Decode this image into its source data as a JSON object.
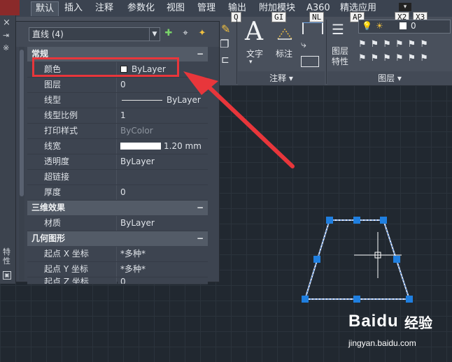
{
  "tabs": [
    "默认",
    "插入",
    "注释",
    "参数化",
    "视图",
    "管理",
    "输出",
    "附加模块",
    "A360",
    "精选应用"
  ],
  "keytips": [
    "O",
    "GI",
    "NL",
    "AP",
    "X2",
    "X3"
  ],
  "ribbon": {
    "text_label": "文字",
    "dim_label": "标注",
    "layer_props_label": "图层特性",
    "annotation_footer": "注释 ▾",
    "layers_footer": "图层 ▾",
    "layer_value": "0"
  },
  "palette": {
    "selection": "直线 (4)",
    "sections": {
      "general": {
        "title": "常规",
        "toggle": "−"
      },
      "3d": {
        "title": "三维效果",
        "toggle": "−"
      },
      "geometry": {
        "title": "几何图形",
        "toggle": "−"
      }
    },
    "general_rows": [
      {
        "key": "颜色",
        "value": "ByLayer"
      },
      {
        "key": "图层",
        "value": "0"
      },
      {
        "key": "线型",
        "value": "ByLayer"
      },
      {
        "key": "线型比例",
        "value": "1"
      },
      {
        "key": "打印样式",
        "value": "ByColor"
      },
      {
        "key": "线宽",
        "value": "1.20 mm"
      },
      {
        "key": "透明度",
        "value": "ByLayer"
      },
      {
        "key": "超链接",
        "value": ""
      },
      {
        "key": "厚度",
        "value": "0"
      }
    ],
    "three_d_rows": [
      {
        "key": "材质",
        "value": "ByLayer"
      }
    ],
    "geometry_rows": [
      {
        "key": "起点 X 坐标",
        "value": "*多种*"
      },
      {
        "key": "起点 Y 坐标",
        "value": "*多种*"
      },
      {
        "key": "起点 Z 坐标",
        "value": "0"
      }
    ],
    "side_label": "特性",
    "side_icons": [
      "×",
      "⇥",
      "※"
    ]
  },
  "watermark": {
    "brand": "Baidu",
    "sub": "经验",
    "url": "jingyan.baidu.com"
  },
  "colors": {
    "highlight": "#e8363b",
    "grip": "#1f7fe0",
    "line": "#6aa0e0"
  }
}
